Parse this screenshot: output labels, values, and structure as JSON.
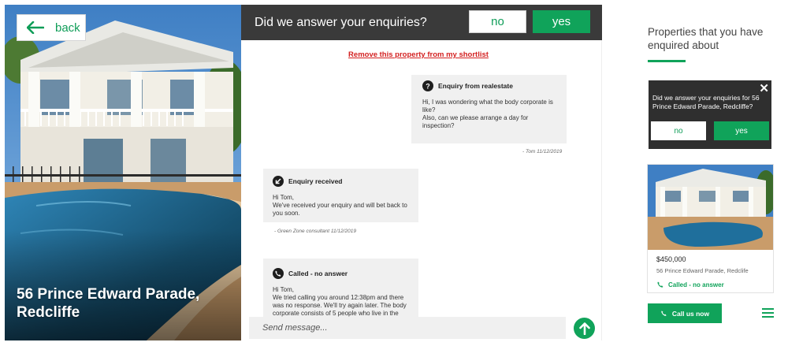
{
  "hero": {
    "back_label": "back",
    "address": "56 Prince Edward Parade, Redcliffe"
  },
  "chat": {
    "question": "Did we answer your enquiries?",
    "no_label": "no",
    "yes_label": "yes",
    "remove_link": "Remove this property from my shortlist",
    "messages": [
      {
        "title": "Enquiry from realestate",
        "icon": "question-icon",
        "body": "Hi, I was wondering what the body corporate is like?\nAlso, can we please arrange a day for inspection?",
        "signature": "- Tom 11/12/2019"
      },
      {
        "title": "Enquiry received",
        "icon": "arrow-in-icon",
        "body": "Hi Tom,\nWe've received your enquiry and will bet back to you soon.",
        "signature": "- Green Zone consultant 11/12/2019"
      },
      {
        "title": "Called - no answer",
        "icon": "phone-icon",
        "body": "Hi Tom,\nWe tried calling you around 12:38pm and there was no response. We'll try again later. The body corporate consists of 5 people who live in the"
      }
    ],
    "composer_placeholder": "Send message..."
  },
  "sidebar": {
    "title": "Properties that you have enquired about",
    "prompt": {
      "text": "Did we answer your enquiries for 56 Prince Edward Parade, Redcliffe?",
      "no_label": "no",
      "yes_label": "yes"
    },
    "card": {
      "price": "$450,000",
      "address": "56 Prince Edward Parade, Redclife",
      "status": "Called - no answer"
    },
    "call_label": "Call us now"
  },
  "colors": {
    "accent": "#10a35a",
    "header_dark": "#3a3a3a",
    "danger": "#d32020"
  }
}
